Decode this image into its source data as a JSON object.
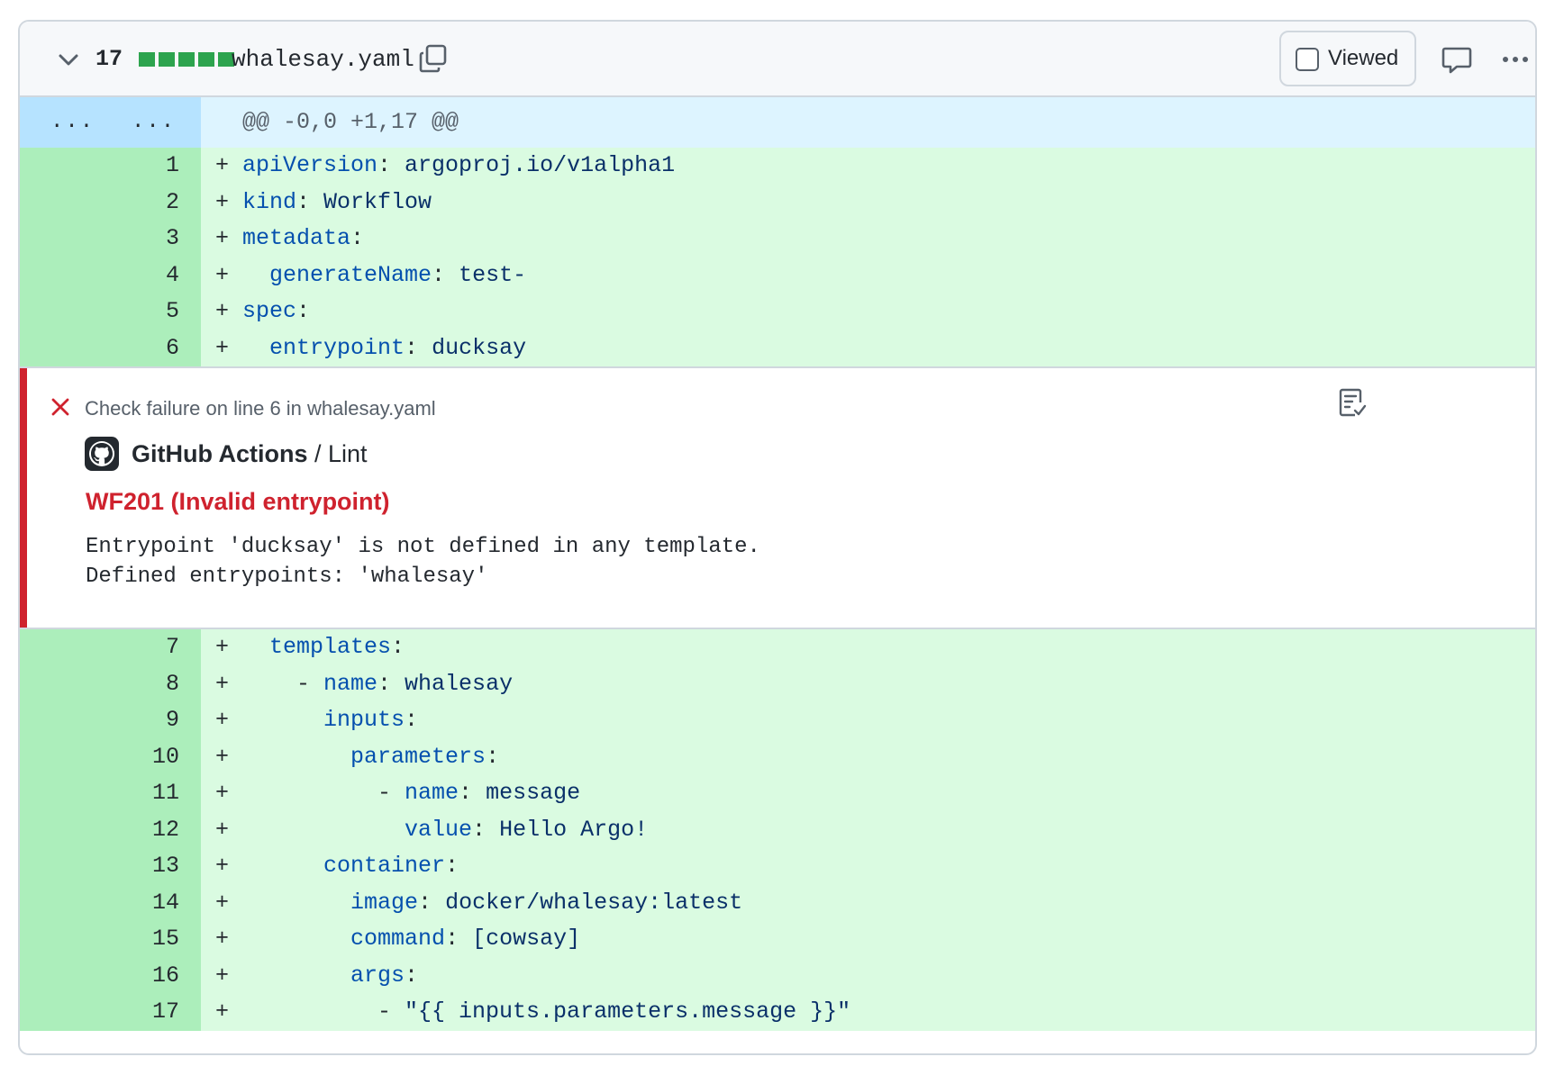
{
  "file": {
    "changes_count": "17",
    "diffstat_blocks": 5,
    "name": "whalesay.yaml",
    "viewed_label": "Viewed",
    "viewed_checked": false
  },
  "hunk": {
    "old_gutter": "...",
    "new_gutter": "...",
    "header": "@@ -0,0 +1,17 @@"
  },
  "lines_before": [
    {
      "num": "1",
      "indent": "",
      "key": "apiVersion",
      "sep": ":",
      "value": " argoproj.io/v1alpha1"
    },
    {
      "num": "2",
      "indent": "",
      "key": "kind",
      "sep": ":",
      "value": " Workflow"
    },
    {
      "num": "3",
      "indent": "",
      "key": "metadata",
      "sep": ":",
      "value": ""
    },
    {
      "num": "4",
      "indent": "  ",
      "key": "generateName",
      "sep": ":",
      "value": " test-"
    },
    {
      "num": "5",
      "indent": "",
      "key": "spec",
      "sep": ":",
      "value": ""
    },
    {
      "num": "6",
      "indent": "  ",
      "key": "entrypoint",
      "sep": ":",
      "value": " ducksay"
    }
  ],
  "annotation": {
    "title": "Check failure on line 6 in whalesay.yaml",
    "source_app": "GitHub Actions",
    "source_sep": " / ",
    "source_check": "Lint",
    "error_title": "WF201 (Invalid entrypoint)",
    "message": "Entrypoint 'ducksay' is not defined in any template.\nDefined entrypoints: 'whalesay'"
  },
  "lines_after": [
    {
      "num": "7",
      "indent": "  ",
      "key": "templates",
      "sep": ":",
      "value": ""
    },
    {
      "num": "8",
      "indent": "    - ",
      "key": "name",
      "sep": ":",
      "value": " whalesay"
    },
    {
      "num": "9",
      "indent": "      ",
      "key": "inputs",
      "sep": ":",
      "value": ""
    },
    {
      "num": "10",
      "indent": "        ",
      "key": "parameters",
      "sep": ":",
      "value": ""
    },
    {
      "num": "11",
      "indent": "          - ",
      "key": "name",
      "sep": ":",
      "value": " message"
    },
    {
      "num": "12",
      "indent": "            ",
      "key": "value",
      "sep": ":",
      "value": " Hello Argo!"
    },
    {
      "num": "13",
      "indent": "      ",
      "key": "container",
      "sep": ":",
      "value": ""
    },
    {
      "num": "14",
      "indent": "        ",
      "key": "image",
      "sep": ":",
      "value": " docker/whalesay:latest"
    },
    {
      "num": "15",
      "indent": "        ",
      "key": "command",
      "sep": ":",
      "value": " [cowsay]"
    },
    {
      "num": "16",
      "indent": "        ",
      "key": "args",
      "sep": ":",
      "value": ""
    },
    {
      "num": "17",
      "indent": "          - ",
      "key": "",
      "sep": "",
      "value": "\"{{ inputs.parameters.message }}\""
    }
  ],
  "plus_sign": "+",
  "colors": {
    "added_bg": "#dafbe1",
    "added_gutter": "#aceebb",
    "hunk_bg": "#ddf4ff",
    "hunk_gutter": "#b6e3ff",
    "diffstat": "#2da44e",
    "error": "#cf222e"
  },
  "icons": [
    "chevron-down-icon",
    "copy-icon",
    "comment-icon",
    "kebab-horizontal-icon",
    "x-icon",
    "checklist-icon",
    "github-mark-icon"
  ]
}
